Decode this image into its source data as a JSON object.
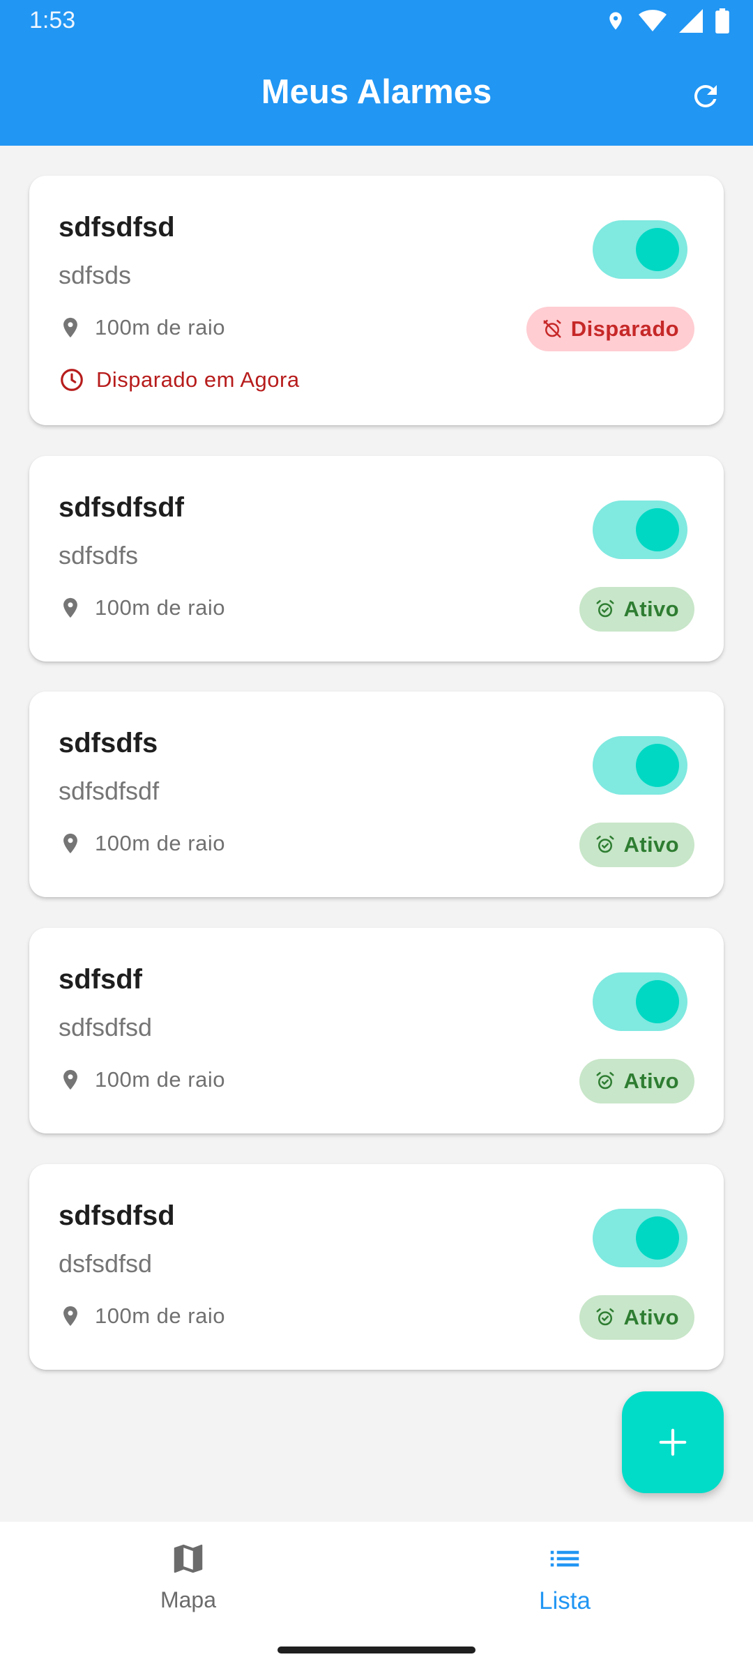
{
  "status_bar": {
    "time": "1:53",
    "icons": [
      "location-icon",
      "wifi-icon",
      "signal-icon",
      "battery-icon"
    ]
  },
  "app_bar": {
    "title": "Meus Alarmes",
    "action_icon": "refresh-icon",
    "color": "#2196f3"
  },
  "alarms": [
    {
      "name": "sdfsdfsd",
      "description": "sdfsds",
      "radius": "100m de raio",
      "enabled": true,
      "status": "Disparado",
      "status_type": "fired",
      "fired_text": "Disparado em Agora"
    },
    {
      "name": "sdfsdfsdf",
      "description": "sdfsdfs",
      "radius": "100m de raio",
      "enabled": true,
      "status": "Ativo",
      "status_type": "active"
    },
    {
      "name": "sdfsdfs",
      "description": "sdfsdfsdf",
      "radius": "100m de raio",
      "enabled": true,
      "status": "Ativo",
      "status_type": "active"
    },
    {
      "name": "sdfsdf",
      "description": "sdfsdfsd",
      "radius": "100m de raio",
      "enabled": true,
      "status": "Ativo",
      "status_type": "active"
    },
    {
      "name": "sdfsdfsd",
      "description": "dsfsdfsd",
      "radius": "100m de raio",
      "enabled": true,
      "status": "Ativo",
      "status_type": "active"
    }
  ],
  "fab": {
    "icon": "plus-icon",
    "color": "#00dcc8"
  },
  "bottom_nav": {
    "items": [
      {
        "label": "Mapa",
        "icon": "map-icon",
        "selected": false
      },
      {
        "label": "Lista",
        "icon": "list-icon",
        "selected": true
      }
    ]
  },
  "colors": {
    "accent": "#2196f3",
    "toggle_track": "#80e9e0",
    "toggle_knob": "#00d8c3",
    "fired_bg": "#ffcdd2",
    "fired_text": "#c62828",
    "active_bg": "#c8e6c9",
    "active_text": "#2e7d32"
  }
}
